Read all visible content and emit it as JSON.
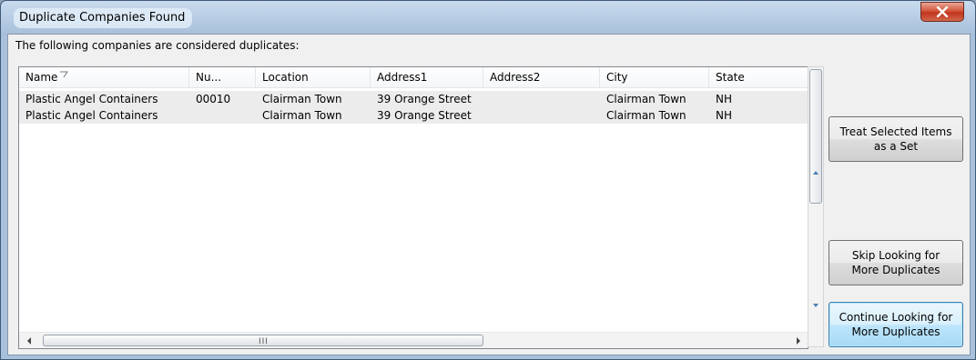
{
  "window": {
    "title": "Duplicate Companies Found"
  },
  "caption": "The following companies are considered duplicates:",
  "grid": {
    "columns": [
      "Name",
      "Nu...",
      "Location",
      "Address1",
      "Address2",
      "City",
      "State"
    ],
    "rows": [
      [
        "Plastic Angel Containers",
        "00010",
        "Clairman Town",
        "39 Orange Street",
        "",
        "Clairman Town",
        "NH"
      ],
      [
        "Plastic Angel Containers",
        "",
        "Clairman Town",
        "39 Orange Street",
        "",
        "Clairman Town",
        "NH"
      ]
    ],
    "hscroll_grip": "III"
  },
  "buttons": {
    "treat_set": "Treat Selected Items as a Set",
    "skip": "Skip Looking for More Duplicates",
    "continue": "Continue Looking for More Duplicates"
  },
  "icons": {
    "close": "close-icon",
    "sort": "sort-descending-icon",
    "scroll_left": "arrow-left-icon",
    "scroll_right": "arrow-right-icon",
    "scroll_up": "arrow-up-icon",
    "scroll_down": "arrow-down-icon"
  },
  "colors": {
    "default_button_border": "#3c7fb1",
    "close_button": "#c2351d",
    "row_background": "#ececec"
  }
}
